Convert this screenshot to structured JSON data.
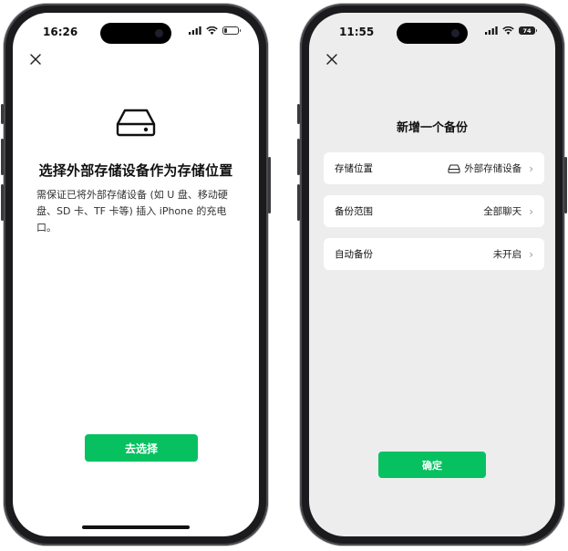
{
  "left_screen": {
    "status_time": "16:26",
    "title": "选择外部存储设备作为存储位置",
    "description": "需保证已将外部存储设备 (如 U 盘、移动硬盘、SD 卡、TF 卡等) 插入 iPhone 的充电口。",
    "primary_button": "去选择"
  },
  "right_screen": {
    "status_time": "11:55",
    "battery_level": "74",
    "title": "新增一个备份",
    "settings": [
      {
        "label": "存储位置",
        "value": "外部存储设备",
        "icon": "hard-drive-icon"
      },
      {
        "label": "备份范围",
        "value": "全部聊天"
      },
      {
        "label": "自动备份",
        "value": "未开启"
      }
    ],
    "confirm_button": "确定"
  },
  "colors": {
    "accent": "#07c160"
  }
}
